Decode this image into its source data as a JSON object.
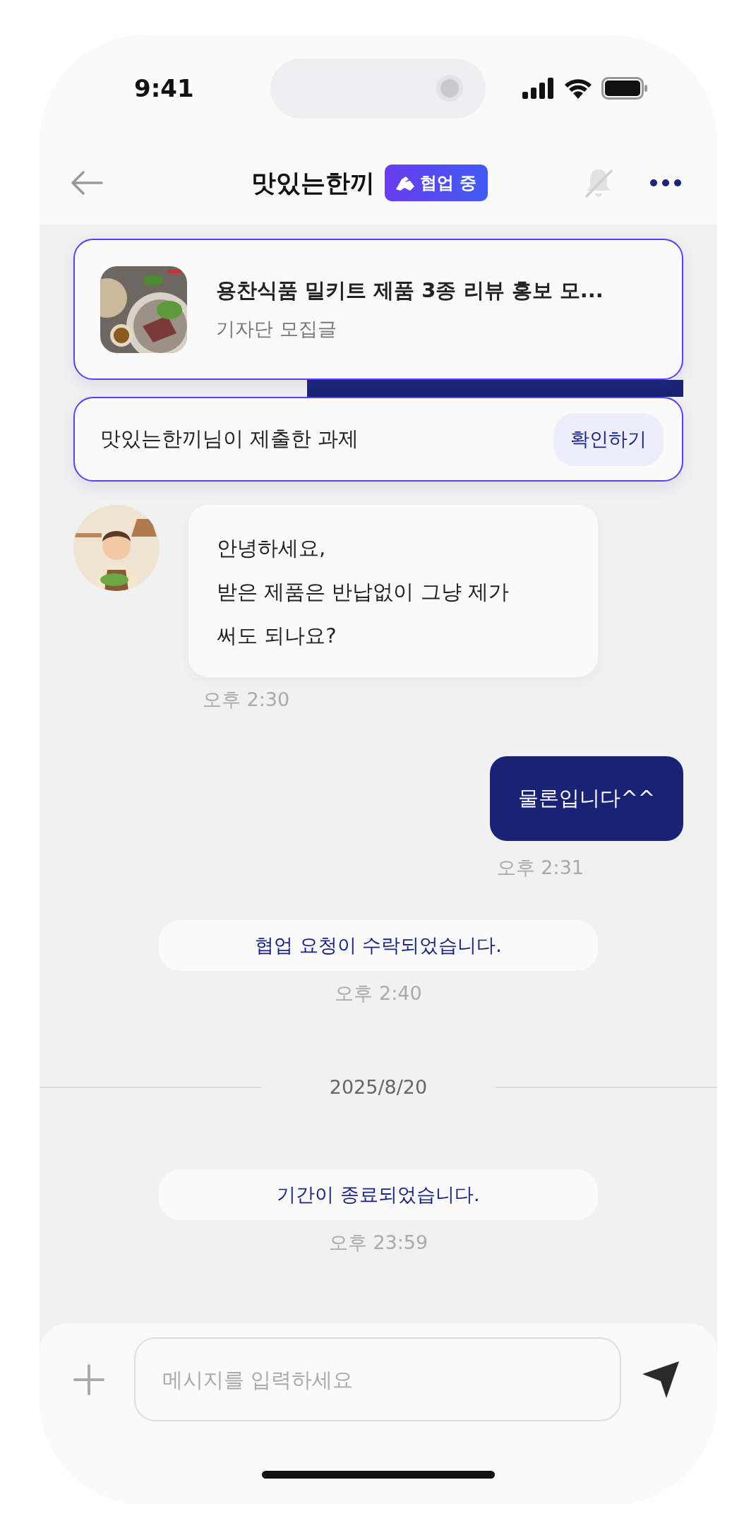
{
  "status_bar": {
    "time": "9:41"
  },
  "header": {
    "title": "맛있는한끼",
    "badge": "협업 중",
    "notifications_muted": true
  },
  "pinned": [
    {
      "kind": "post",
      "title": "용찬식품 밀키트 제품 3종 리뷰 홍보 모...",
      "subtitle": "기자단 모집글"
    },
    {
      "kind": "task",
      "text": "맛있는한끼님이 제출한 과제",
      "button": "확인하기"
    }
  ],
  "messages": [
    {
      "kind": "received",
      "text": "안녕하세요,\n받은 제품은 반납없이 그냥 제가\n써도 되나요?",
      "time": "오후 2:30"
    },
    {
      "kind": "sent",
      "text": "물론입니다^^",
      "time": "오후 2:31"
    },
    {
      "kind": "system",
      "text": "협업 요청이 수락되었습니다.",
      "time": "오후 2:40"
    },
    {
      "kind": "date",
      "text": "2025/8/20"
    },
    {
      "kind": "system",
      "text": "기간이 종료되었습니다.",
      "time": "오후 23:59"
    }
  ],
  "composer": {
    "placeholder": "메시지를 입력하세요"
  }
}
